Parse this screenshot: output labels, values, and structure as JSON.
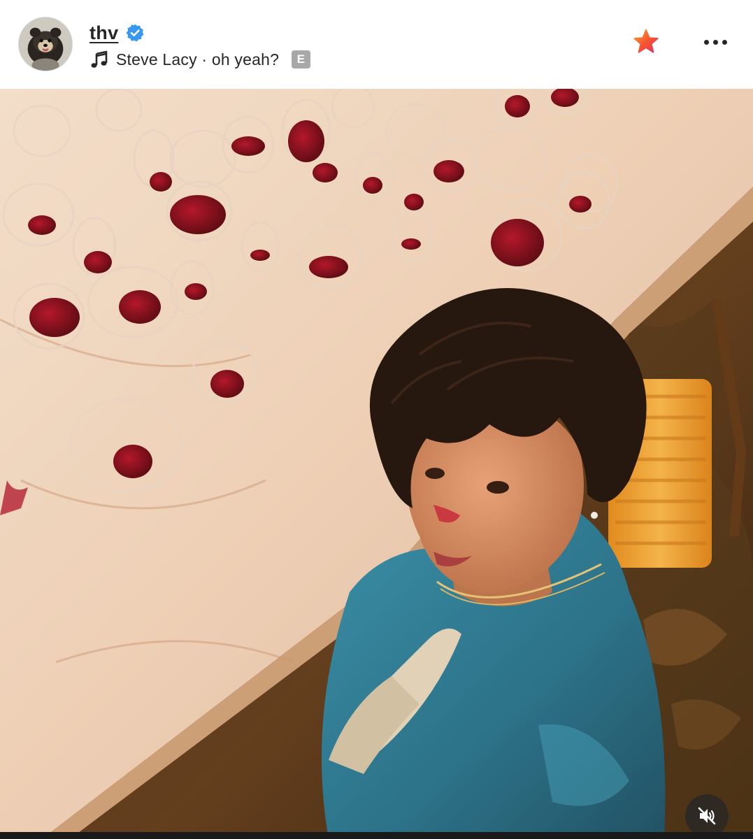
{
  "post": {
    "username": "thv",
    "verified_icon": "verified-badge-icon",
    "music_icon": "music-note-icon",
    "music_text": "Steve Lacy · oh yeah?",
    "explicit_badge": "E",
    "star_icon": "star-icon",
    "more_icon": "more-options-icon",
    "mute_icon": "speaker-muted-icon",
    "photo_description_icon": "post-photo",
    "colors": {
      "verified": "#3897f0",
      "star_start": "#f77737",
      "star_end": "#e1306c",
      "text": "#262626",
      "explicit_bg": "#a8a8a8"
    }
  }
}
